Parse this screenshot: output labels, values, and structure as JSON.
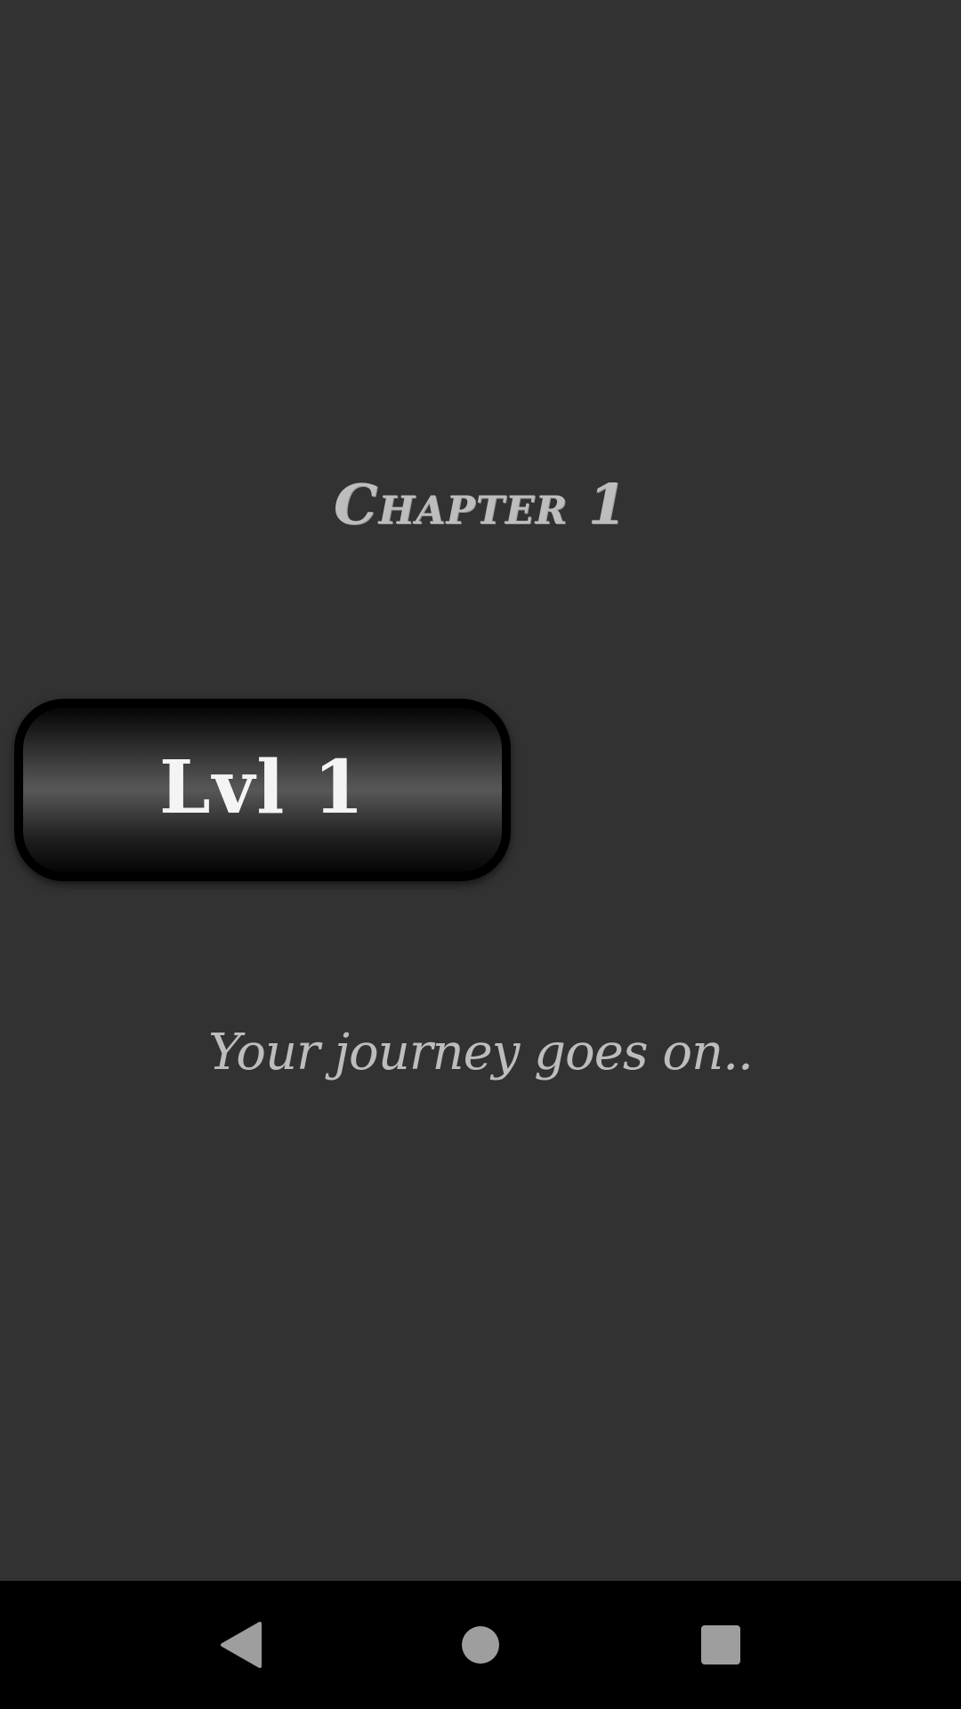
{
  "chapter": {
    "title": "Chapter 1"
  },
  "level_button": {
    "label": "Lvl 1"
  },
  "tagline": "Your journey goes on..",
  "nav_bar": {
    "icons": [
      "back-icon",
      "home-icon",
      "recents-icon"
    ]
  },
  "colors": {
    "background": "#323232",
    "text": "#bdbdbd",
    "button_text": "#f4f4f4",
    "nav_bar": "#000000",
    "nav_icons": "#9e9e9e"
  }
}
